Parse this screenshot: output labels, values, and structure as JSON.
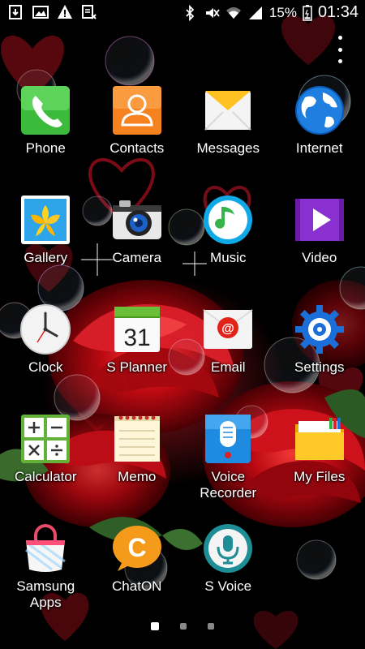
{
  "status_bar": {
    "notification_icons": [
      "download-icon",
      "image-icon",
      "alert-icon",
      "storage-icon"
    ],
    "system_icons": [
      "bluetooth-icon",
      "mute-icon",
      "wifi-icon",
      "signal-icon"
    ],
    "battery_percent": "15%",
    "battery_level": 0.15,
    "time": "01:34"
  },
  "apps": [
    {
      "name": "phone",
      "label": "Phone",
      "icon": "phone-icon"
    },
    {
      "name": "contacts",
      "label": "Contacts",
      "icon": "contacts-icon"
    },
    {
      "name": "messages",
      "label": "Messages",
      "icon": "messages-icon"
    },
    {
      "name": "internet",
      "label": "Internet",
      "icon": "globe-icon"
    },
    {
      "name": "gallery",
      "label": "Gallery",
      "icon": "gallery-icon"
    },
    {
      "name": "camera",
      "label": "Camera",
      "icon": "camera-icon"
    },
    {
      "name": "music",
      "label": "Music",
      "icon": "music-icon"
    },
    {
      "name": "video",
      "label": "Video",
      "icon": "video-icon"
    },
    {
      "name": "clock",
      "label": "Clock",
      "icon": "clock-icon"
    },
    {
      "name": "s-planner",
      "label": "S Planner",
      "icon": "calendar-icon",
      "day": "31"
    },
    {
      "name": "email",
      "label": "Email",
      "icon": "email-icon"
    },
    {
      "name": "settings",
      "label": "Settings",
      "icon": "gear-icon"
    },
    {
      "name": "calculator",
      "label": "Calculator",
      "icon": "calculator-icon"
    },
    {
      "name": "memo",
      "label": "Memo",
      "icon": "memo-icon"
    },
    {
      "name": "voice-recorder",
      "label": "Voice\nRecorder",
      "icon": "microphone-icon"
    },
    {
      "name": "my-files",
      "label": "My Files",
      "icon": "folder-icon"
    },
    {
      "name": "samsung-apps",
      "label": "Samsung\nApps",
      "icon": "shopping-bag-icon"
    },
    {
      "name": "chaton",
      "label": "ChatON",
      "icon": "chat-icon"
    },
    {
      "name": "s-voice",
      "label": "S Voice",
      "icon": "voice-icon"
    }
  ],
  "pagination": {
    "pages": 3,
    "current": 1
  }
}
